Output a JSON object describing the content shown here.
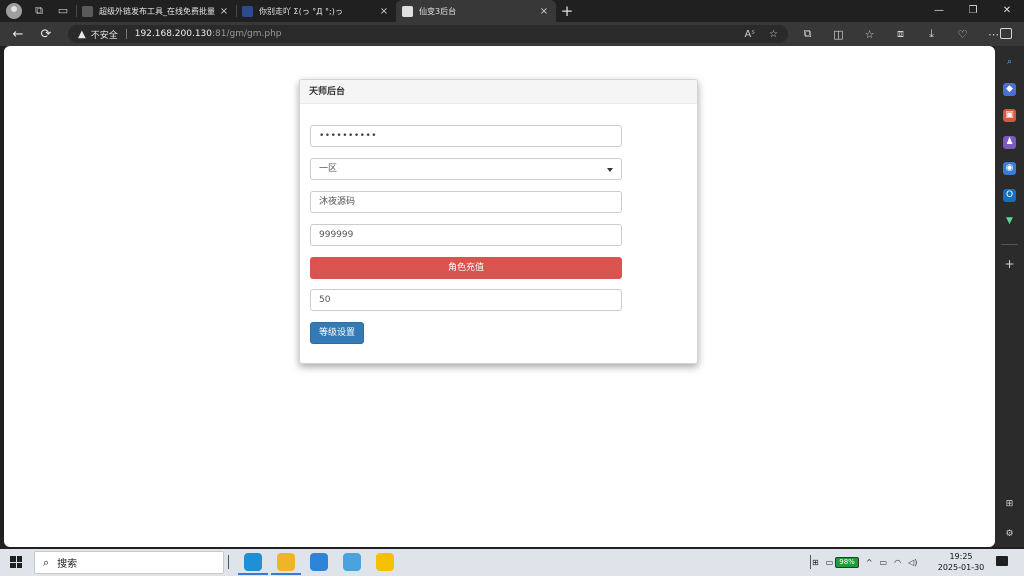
{
  "browser": {
    "tabs": [
      {
        "title": "超级外链发布工具_在线免费批量",
        "favicon_color": "#5a5a5a",
        "active": false
      },
      {
        "title": "你别走吖 Σ(っ °Д °;)っ",
        "favicon_color": "#2b4c8c",
        "active": false
      },
      {
        "title": "仙变3后台",
        "favicon_color": "#e0e0e0",
        "active": true
      }
    ],
    "close_glyph": "×",
    "new_tab_glyph": "+",
    "window_controls": [
      "—",
      "❐",
      "✕"
    ],
    "security_label": "不安全",
    "url_host": "192.168.200.130",
    "url_rest": ":81/gm/gm.php",
    "nav_icons": [
      "←",
      "⟳"
    ],
    "addr_icons": [
      "Aˢ",
      "☆"
    ],
    "toolbar_icons": [
      "⧉",
      "◫",
      "☆",
      "⧈",
      "⤓",
      "♡",
      "⋯"
    ]
  },
  "panel": {
    "title": "天师后台",
    "password_value": "••••••••••",
    "server_select": "一区",
    "role_name": "沐夜源码",
    "amount": "999999",
    "recharge_button": "角色充值",
    "level": "50",
    "level_button": "等级设置"
  },
  "sidebar": {
    "icons": [
      {
        "name": "search-icon",
        "glyph": "⌕",
        "color": "#2b2b2b",
        "fg": "#6aa8ff"
      },
      {
        "name": "tag-icon",
        "glyph": "◆",
        "color": "#4a6fd6",
        "fg": "#ffffff"
      },
      {
        "name": "toolbox-icon",
        "glyph": "▣",
        "color": "#d9583b",
        "fg": "#ffffff"
      },
      {
        "name": "people-icon",
        "glyph": "♟",
        "color": "#7d5bbe",
        "fg": "#ffffff"
      },
      {
        "name": "copilot-icon",
        "glyph": "◉",
        "color": "#3a7bd5",
        "fg": "#ffffff"
      },
      {
        "name": "outlook-icon",
        "glyph": "O",
        "color": "#1470c4",
        "fg": "#ffffff"
      },
      {
        "name": "drop-icon",
        "glyph": "▼",
        "color": "#2b2b2b",
        "fg": "#5fd39c"
      }
    ],
    "add_glyph": "+",
    "bottom_icons": [
      "⊞",
      "⚙"
    ]
  },
  "taskbar": {
    "search_placeholder": "搜索",
    "search_glyph": "⌕",
    "apps": [
      {
        "name": "edge-icon",
        "color": "#1f8fd6"
      },
      {
        "name": "file-explorer-icon",
        "color": "#f0b429"
      },
      {
        "name": "app-window-icon",
        "color": "#2f84d8"
      },
      {
        "name": "store-icon",
        "color": "#4aa3df"
      },
      {
        "name": "app-yellow-icon",
        "color": "#f5c000"
      }
    ],
    "tray": [
      "⊞",
      "▭",
      "^",
      "▭",
      "◠",
      "◁)"
    ],
    "battery": "98%",
    "time": "19:25",
    "date": "2025-01-30"
  }
}
